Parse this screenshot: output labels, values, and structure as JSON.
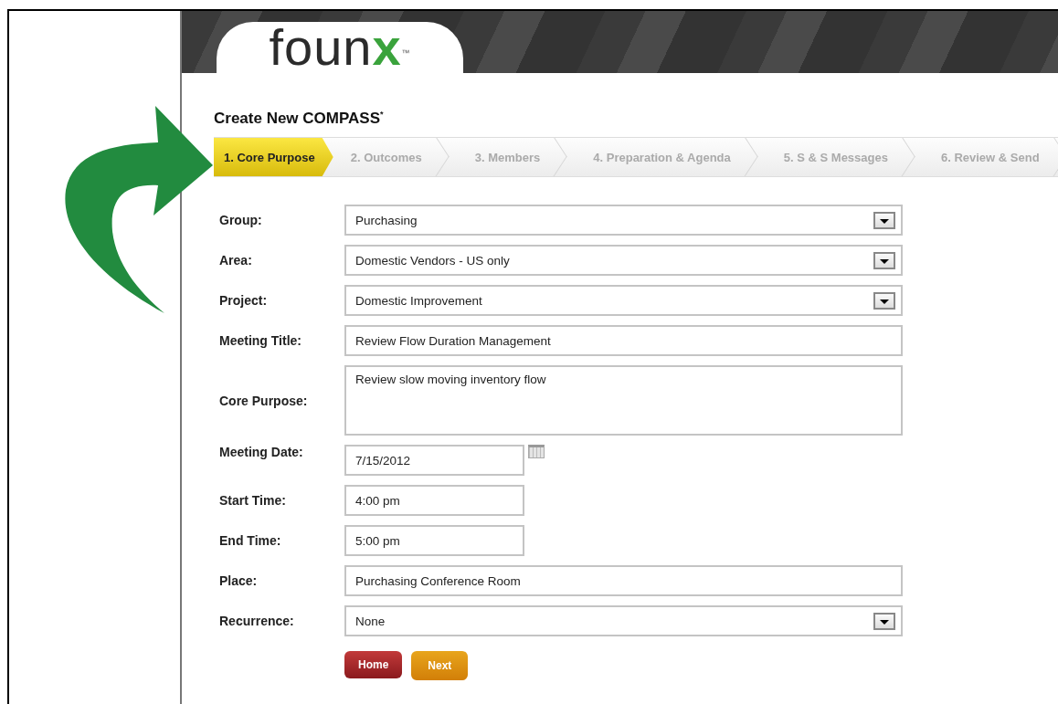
{
  "logo": {
    "main": "foun",
    "accent": "x",
    "mark": "™"
  },
  "title": {
    "text": "Create New COMPASS",
    "mark": "*"
  },
  "steps": [
    {
      "label": "1. Core Purpose",
      "selected": true
    },
    {
      "label": "2. Outcomes",
      "selected": false
    },
    {
      "label": "3. Members",
      "selected": false
    },
    {
      "label": "4. Preparation & Agenda",
      "selected": false
    },
    {
      "label": "5. S & S Messages",
      "selected": false
    },
    {
      "label": "6. Review & Send",
      "selected": false
    }
  ],
  "form": [
    {
      "label": "Group:",
      "kind": "select",
      "value": "Purchasing"
    },
    {
      "label": "Area:",
      "kind": "select",
      "value": "Domestic Vendors - US only"
    },
    {
      "label": "Project:",
      "kind": "select",
      "value": "Domestic Improvement"
    },
    {
      "label": "Meeting Title:",
      "kind": "text",
      "value": "Review Flow Duration Management"
    },
    {
      "label": "Core Purpose:",
      "kind": "textarea",
      "value": "Review slow moving inventory flow"
    },
    {
      "label": "Meeting Date:",
      "kind": "date",
      "value": "7/15/2012"
    },
    {
      "label": "Start Time:",
      "kind": "short",
      "value": "4:00 pm"
    },
    {
      "label": "End Time:",
      "kind": "short",
      "value": "5:00 pm"
    },
    {
      "label": "Place:",
      "kind": "text",
      "value": "Purchasing Conference Room"
    },
    {
      "label": "Recurrence:",
      "kind": "select",
      "value": "None"
    }
  ],
  "buttons": [
    {
      "label": "Home",
      "kind": "secondary"
    },
    {
      "label": "Next",
      "kind": "primary"
    }
  ]
}
